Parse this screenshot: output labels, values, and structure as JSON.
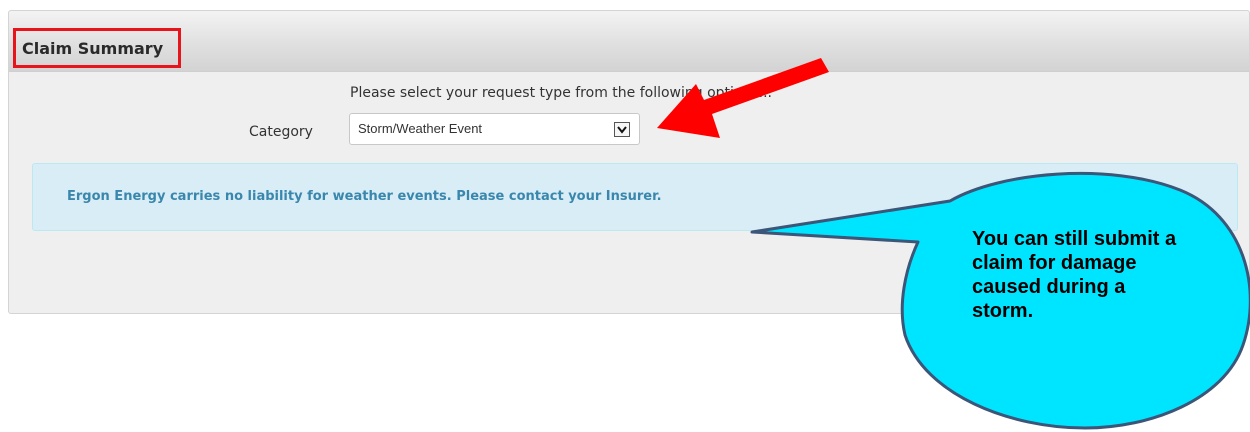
{
  "header": {
    "title": "Claim Summary"
  },
  "form": {
    "instruction": "Please select your request type from the following options...",
    "category_label": "Category",
    "category_selected": "Storm/Weather Event"
  },
  "alert": {
    "message": "Ergon Energy carries no liability for weather events. Please contact your Insurer."
  },
  "annotation": {
    "callout_text": "You can still submit a claim for damage caused during a storm.",
    "callout_color": "#00e5ff",
    "arrow_color": "#ff0000",
    "highlight_color": "#e8141b"
  },
  "colors": {
    "alert_background": "#d9edf7",
    "alert_text": "#3a87ad",
    "panel_background": "#efefef"
  }
}
